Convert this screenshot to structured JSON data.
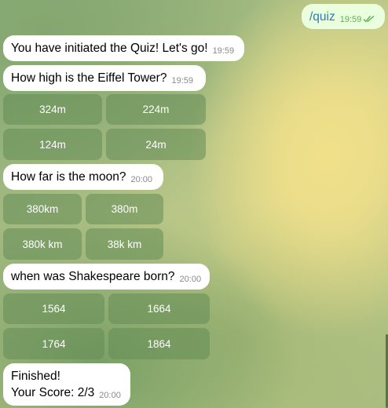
{
  "colors": {
    "incoming_bubble": "#ffffff",
    "outgoing_bubble": "#eaffdd",
    "outgoing_text": "#2a7bc0",
    "outgoing_time": "#5bb152",
    "keyboard_button": "#7f9f6e"
  },
  "messages": {
    "outgoing_quiz": {
      "text": "/quiz",
      "time": "19:59",
      "status_icon": "double-check-icon"
    },
    "intro": {
      "text": "You have initiated the Quiz! Let's go!",
      "time": "19:59"
    },
    "q1": {
      "text": "How high is the Eiffel Tower?",
      "time": "19:59",
      "options": [
        "324m",
        "224m",
        "124m",
        "24m"
      ]
    },
    "q2": {
      "text": "How far is the moon?",
      "time": "20:00",
      "options": [
        "380km",
        "380m",
        "380k km",
        "38k km"
      ]
    },
    "q3": {
      "text": "when was Shakespeare born?",
      "time": "20:00",
      "options": [
        "1564",
        "1664",
        "1764",
        "1864"
      ]
    },
    "result": {
      "text": "Finished!\nYour Score: 2/3",
      "time": "20:00"
    }
  }
}
